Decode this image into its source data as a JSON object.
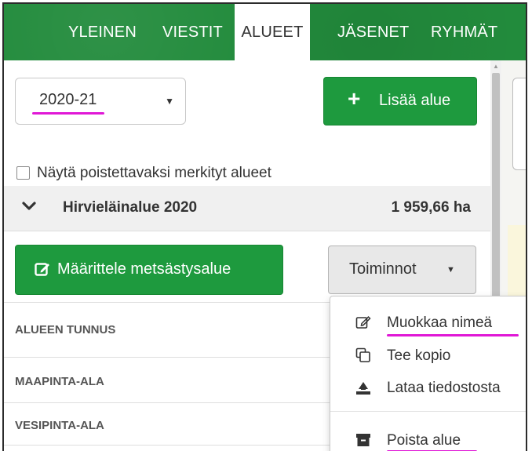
{
  "nav": {
    "tabs": [
      {
        "label": "YLEINEN"
      },
      {
        "label": "VIESTIT"
      },
      {
        "label": "ALUEET"
      },
      {
        "label": "JÄSENET"
      },
      {
        "label": "RYHMÄT"
      }
    ],
    "active_tab": "ALUEET"
  },
  "season_select": {
    "value": "2020-21"
  },
  "add_area_button": {
    "label": "Lisää alue",
    "icon": "plus-icon"
  },
  "show_deleted_checkbox": {
    "label": "Näytä poistettavaksi merkityt alueet",
    "checked": false
  },
  "area": {
    "name": "Hirvieläinalue 2020",
    "size": "1 959,66 ha",
    "expanded": true
  },
  "define_button": {
    "label": "Määrittele metsästysalue",
    "icon": "edit-icon"
  },
  "tools_button": {
    "label": "Toiminnot"
  },
  "properties": [
    {
      "label": "ALUEEN TUNNUS"
    },
    {
      "label": "MAAPINTA-ALA"
    },
    {
      "label": "VESIPINTA-ALA"
    }
  ],
  "tools_menu": [
    {
      "label": "Muokkaa nimeä",
      "icon": "edit-icon"
    },
    {
      "label": "Tee kopio",
      "icon": "copy-icon"
    },
    {
      "label": "Lataa tiedostosta",
      "icon": "upload-icon"
    },
    {
      "label": "Poista alue",
      "icon": "archive-icon"
    }
  ],
  "colors": {
    "brand_green": "#1e9a3e",
    "nav_green": "#228b3c",
    "annotation": "#e018d6"
  }
}
